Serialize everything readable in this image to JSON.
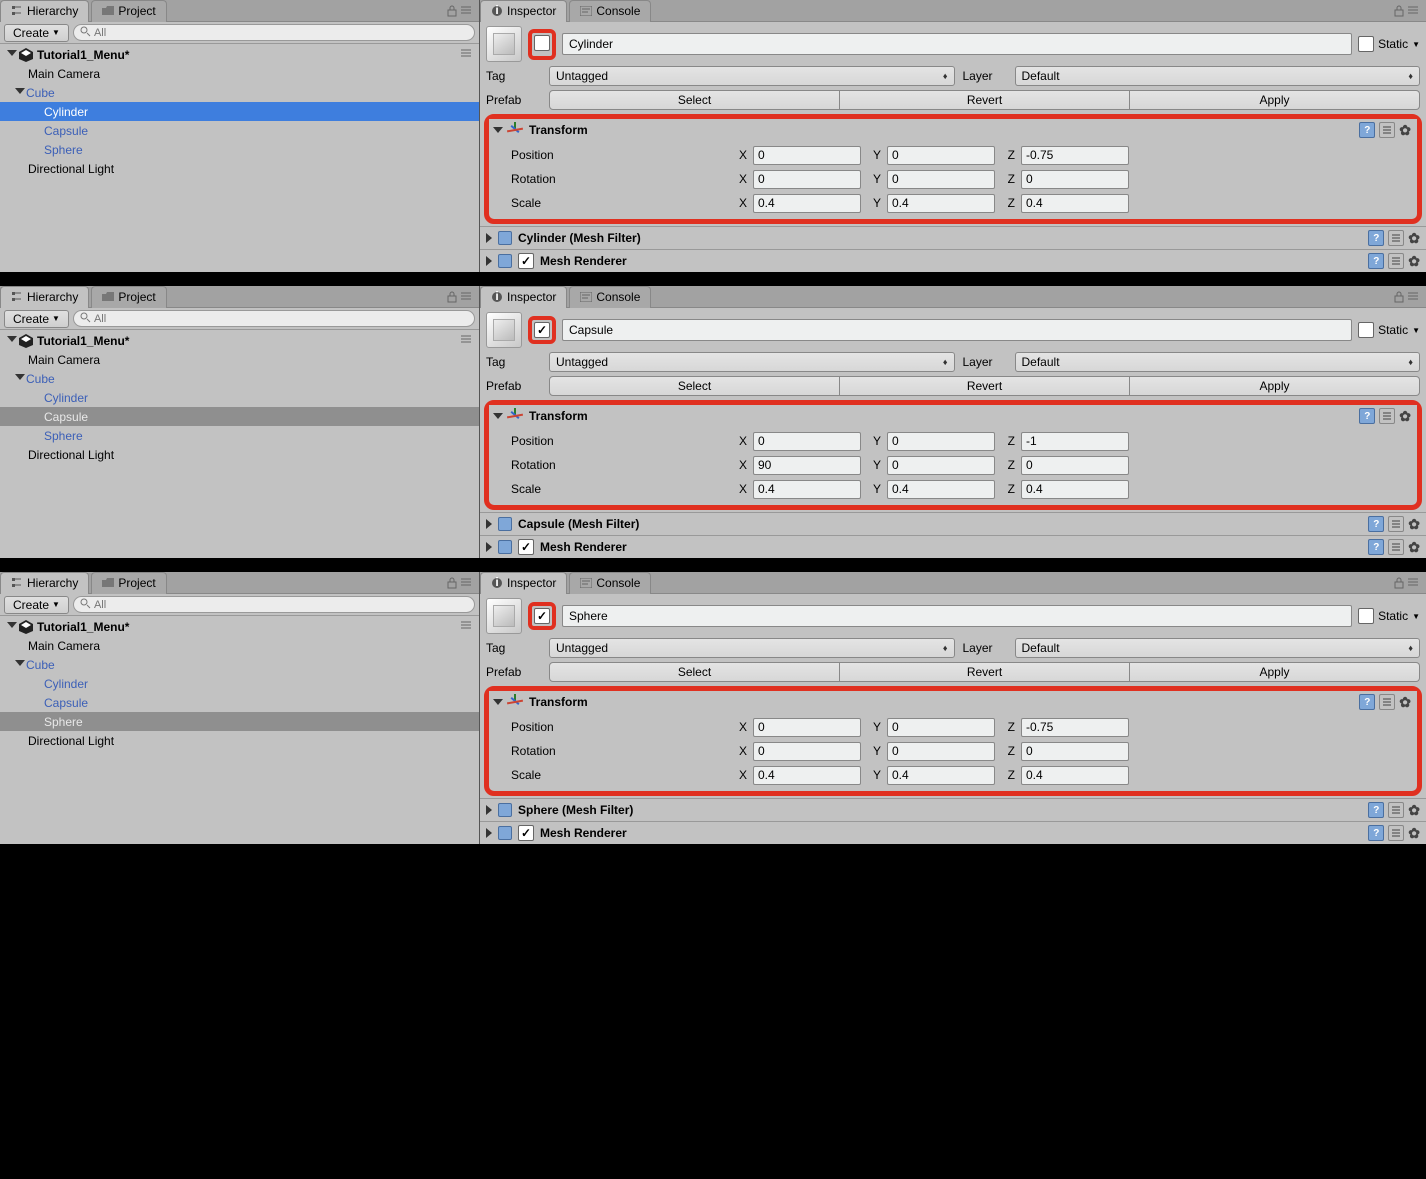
{
  "tabs": {
    "hierarchy": "Hierarchy",
    "project": "Project",
    "inspector": "Inspector",
    "console": "Console"
  },
  "toolbar": {
    "create": "Create",
    "search_placeholder": "All"
  },
  "scene": "Tutorial1_Menu*",
  "tree": {
    "main_camera": "Main Camera",
    "cube": "Cube",
    "cylinder": "Cylinder",
    "capsule": "Capsule",
    "sphere": "Sphere",
    "dir_light": "Directional Light"
  },
  "insp": {
    "static": "Static",
    "tag": "Tag",
    "tag_value": "Untagged",
    "layer": "Layer",
    "layer_value": "Default",
    "prefab": "Prefab",
    "select": "Select",
    "revert": "Revert",
    "apply": "Apply"
  },
  "transform": {
    "title": "Transform",
    "position": "Position",
    "rotation": "Rotation",
    "scale": "Scale",
    "x": "X",
    "y": "Y",
    "z": "Z"
  },
  "meshfilter": {
    "suffix": " (Mesh Filter)"
  },
  "meshrenderer": "Mesh Renderer",
  "rows": [
    {
      "name": "Cylinder",
      "selected": "cylinder",
      "sel_style": "sel",
      "enabled_checked": false,
      "mesh_filter": "Cylinder",
      "pos": {
        "x": "0",
        "y": "0",
        "z": "-0.75"
      },
      "rot": {
        "x": "0",
        "y": "0",
        "z": "0"
      },
      "scl": {
        "x": "0.4",
        "y": "0.4",
        "z": "0.4"
      }
    },
    {
      "name": "Capsule",
      "selected": "capsule",
      "sel_style": "sel-gray",
      "enabled_checked": true,
      "mesh_filter": "Capsule",
      "pos": {
        "x": "0",
        "y": "0",
        "z": "-1"
      },
      "rot": {
        "x": "90",
        "y": "0",
        "z": "0"
      },
      "scl": {
        "x": "0.4",
        "y": "0.4",
        "z": "0.4"
      }
    },
    {
      "name": "Sphere",
      "selected": "sphere",
      "sel_style": "sel-gray",
      "enabled_checked": true,
      "mesh_filter": "Sphere",
      "pos": {
        "x": "0",
        "y": "0",
        "z": "-0.75"
      },
      "rot": {
        "x": "0",
        "y": "0",
        "z": "0"
      },
      "scl": {
        "x": "0.4",
        "y": "0.4",
        "z": "0.4"
      }
    }
  ]
}
